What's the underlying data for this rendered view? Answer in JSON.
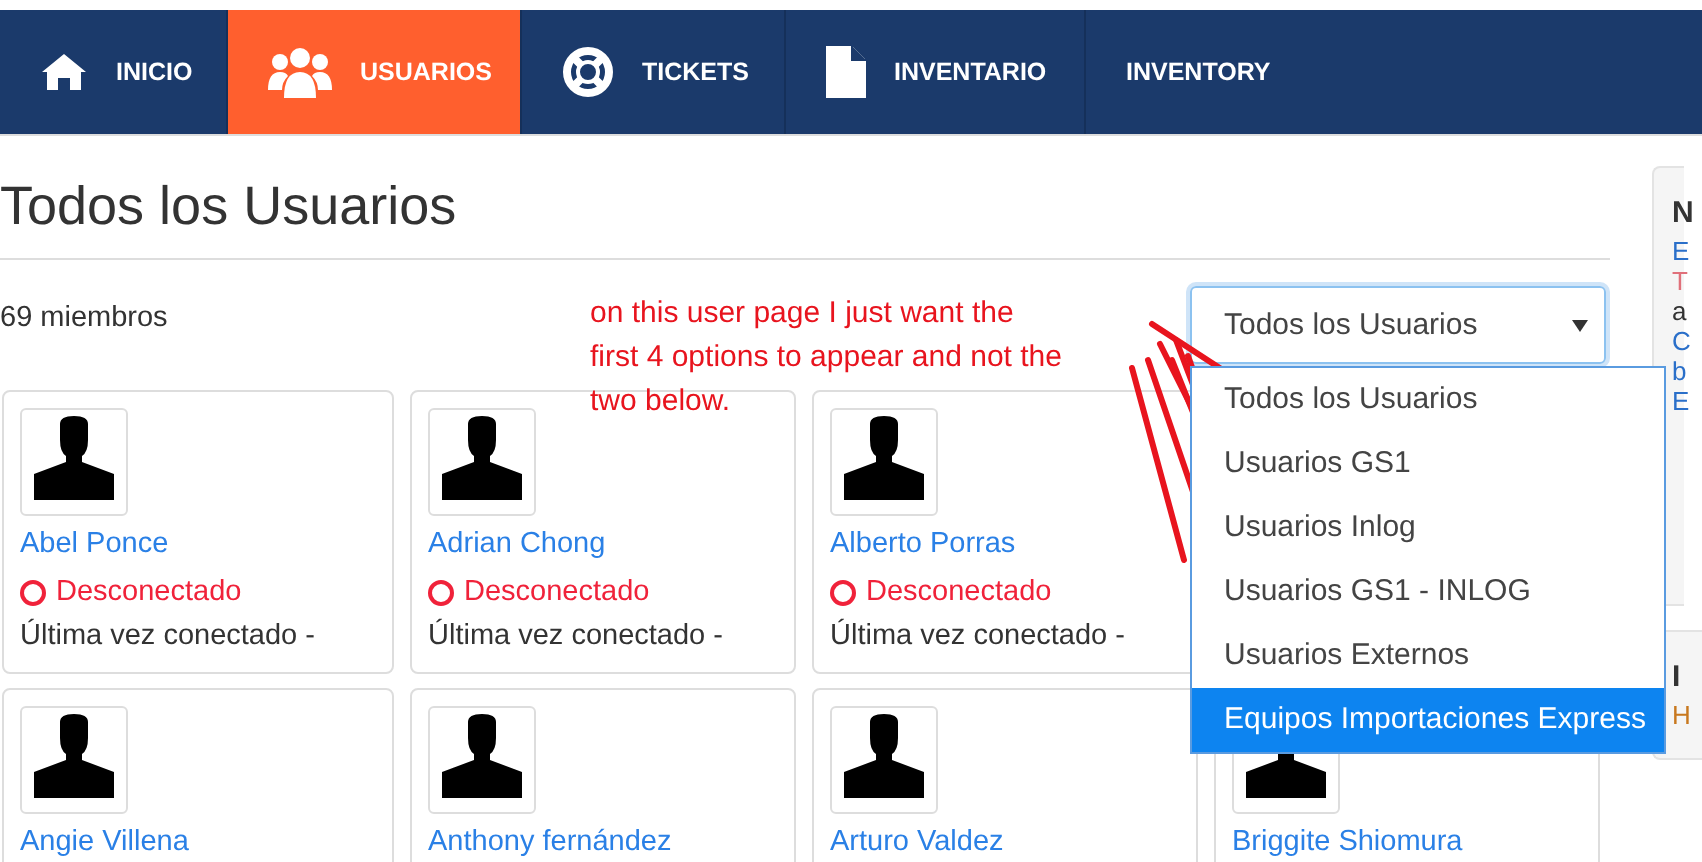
{
  "nav": [
    {
      "label": "INICIO",
      "selected": false
    },
    {
      "label": "USUARIOS",
      "selected": true
    },
    {
      "label": "TICKETS",
      "selected": false
    },
    {
      "label": "INVENTARIO",
      "selected": false
    },
    {
      "label": "INVENTORY",
      "selected": false
    }
  ],
  "page_title": "Todos los Usuarios",
  "member_count": "69 miembros",
  "filter": {
    "value": "Todos los Usuarios",
    "expanded": true,
    "options": [
      {
        "label": "Todos los Usuarios",
        "highlighted": false
      },
      {
        "label": "Usuarios GS1",
        "highlighted": false
      },
      {
        "label": "Usuarios Inlog",
        "highlighted": false
      },
      {
        "label": "Usuarios GS1 - INLOG",
        "highlighted": false
      },
      {
        "label": "Usuarios Externos",
        "highlighted": false
      },
      {
        "label": "Equipos Importaciones Express",
        "highlighted": true
      }
    ]
  },
  "members": [
    {
      "name": "Abel Ponce",
      "online": false,
      "status": "Desconectado",
      "last_seen": "Última vez conectado -"
    },
    {
      "name": "Adrian Chong",
      "online": false,
      "status": "Desconectado",
      "last_seen": "Última vez conectado -"
    },
    {
      "name": "Alberto Porras",
      "online": false,
      "status": "Desconectado",
      "last_seen": "Última vez conectado -"
    },
    {
      "name": "Angie Villena"
    },
    {
      "name": "Anthony fernández"
    },
    {
      "name": "Arturo Valdez"
    },
    {
      "name": "Briggite Shiomura"
    }
  ],
  "annotation": {
    "note_lines": [
      "on this user page I just want the",
      "first 4 options to appear and not the",
      "two below."
    ]
  },
  "sidebar_panels": [
    {
      "title": "N",
      "lines": [
        {
          "text": "E",
          "color": "#2a6fc9"
        },
        {
          "text": "T",
          "color": "#e0707a"
        },
        {
          "text": "a",
          "color": "#333333"
        },
        {
          "text": "C",
          "color": "#2a6fc9"
        },
        {
          "text": "b",
          "color": "#2a6fc9"
        },
        {
          "text": "E",
          "color": "#2a6fc9"
        }
      ]
    },
    {
      "title": "I",
      "lines": [
        {
          "text": "H",
          "color": "#c8781e"
        }
      ]
    }
  ]
}
